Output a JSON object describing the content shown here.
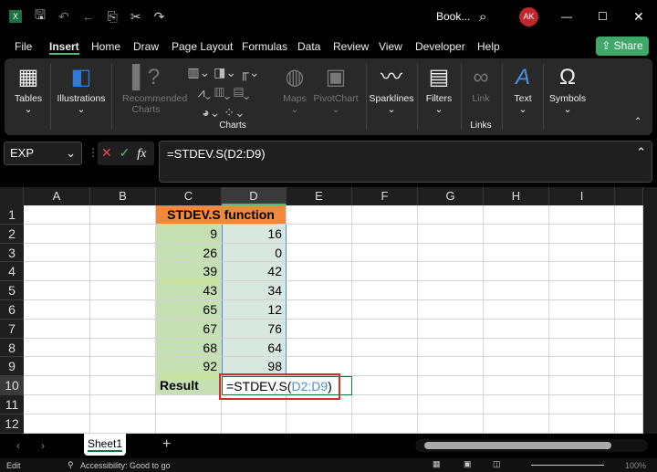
{
  "title": {
    "doc": "Book...",
    "avatar": "AK"
  },
  "tabs": [
    "File",
    "Insert",
    "Home",
    "Draw",
    "Page Layout",
    "Formulas",
    "Data",
    "Review",
    "View",
    "Developer",
    "Help"
  ],
  "share": "Share",
  "ribbon": {
    "tables": "Tables",
    "illustrations": "Illustrations",
    "recommended": "Recommended Charts",
    "maps": "Maps",
    "pivotchart": "PivotChart",
    "charts": "Charts",
    "sparklines": "Sparklines",
    "filters": "Filters",
    "link": "Link",
    "links": "Links",
    "text": "Text",
    "symbols": "Symbols"
  },
  "formula": {
    "namebox": "EXP",
    "fx": "fx",
    "content": "=STDEV.S(D2:D9)"
  },
  "columns": [
    "A",
    "B",
    "C",
    "D",
    "E",
    "F",
    "G",
    "H",
    "I"
  ],
  "rows": [
    "1",
    "2",
    "3",
    "4",
    "5",
    "6",
    "7",
    "8",
    "9",
    "10",
    "11",
    "12"
  ],
  "sheet": {
    "header": "STDEV.S function",
    "c": [
      "9",
      "26",
      "39",
      "43",
      "65",
      "67",
      "68",
      "92"
    ],
    "d": [
      "16",
      "0",
      "42",
      "34",
      "12",
      "76",
      "64",
      "98"
    ],
    "result_label": "Result",
    "result_prefix": "=STDEV.S(",
    "result_ref": "D2:D9",
    "result_suffix": ")"
  },
  "sheettab": "Sheet1",
  "status": {
    "mode": "Edit",
    "accessibility": "Accessibility: Good to go",
    "zoom": "100%"
  },
  "colors": {
    "header": "#f0883e",
    "green": "#c6e0b4",
    "refblue": "#4a90d9",
    "highlight": "#d32f2f"
  }
}
